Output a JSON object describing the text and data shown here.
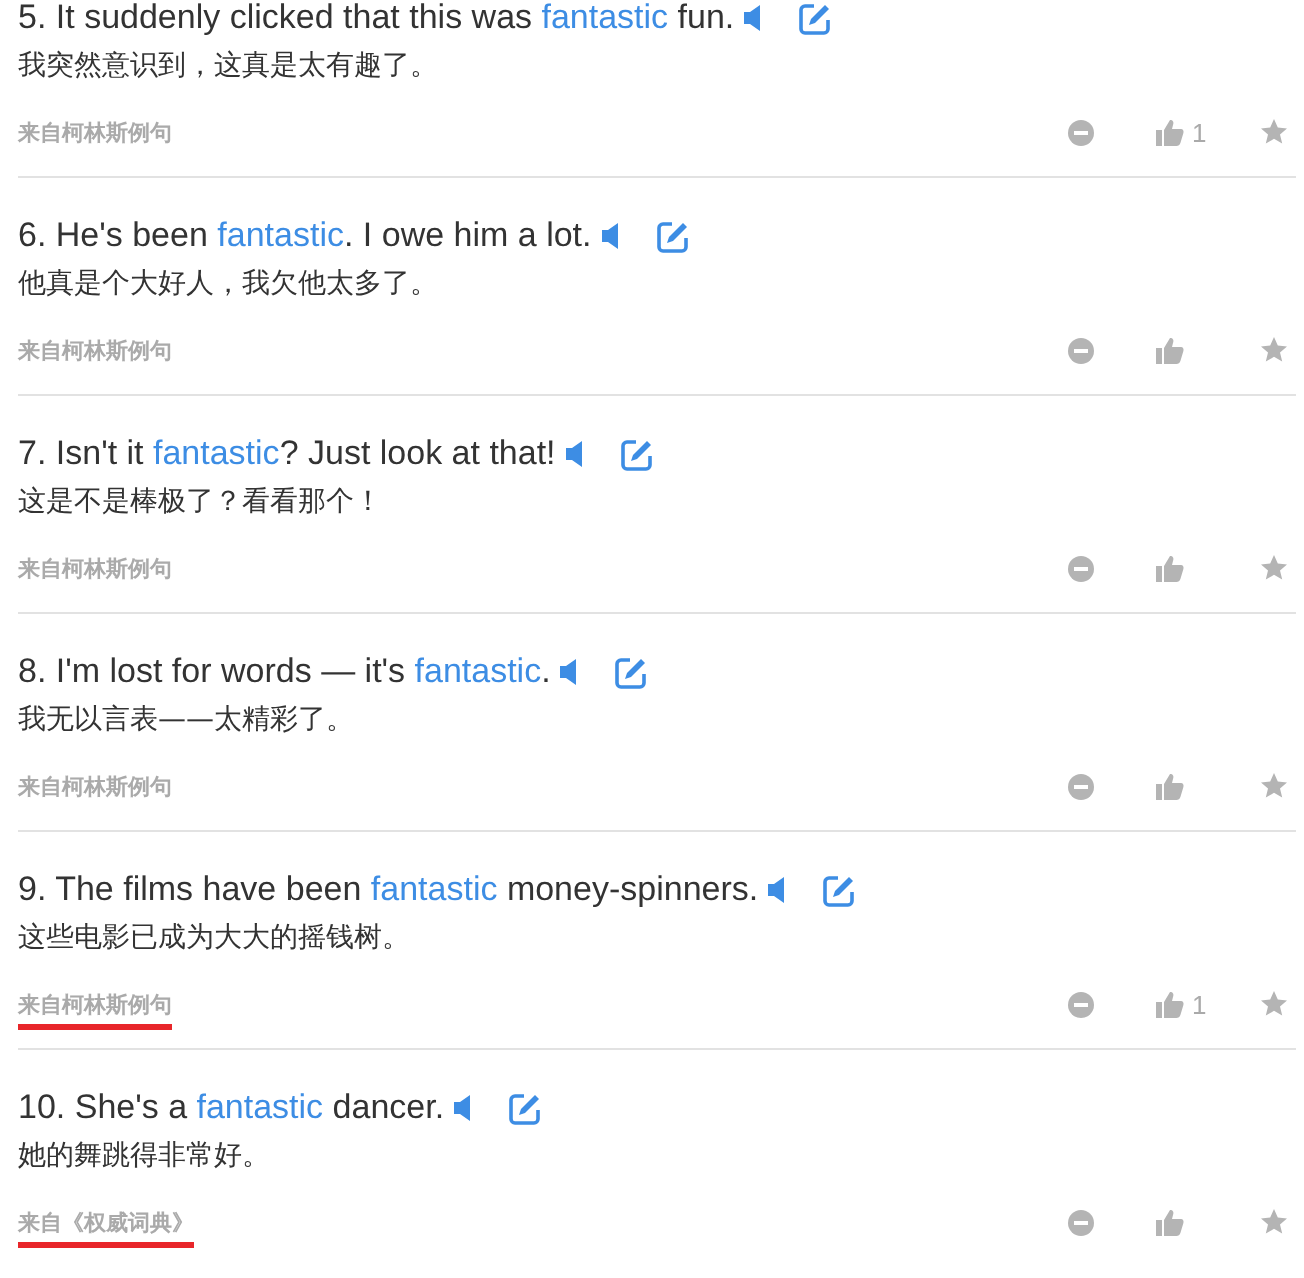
{
  "examples": [
    {
      "parts": [
        {
          "text": "5. It suddenly clicked that this was ",
          "highlight": false
        },
        {
          "text": "fantastic",
          "highlight": true
        },
        {
          "text": " fun.",
          "highlight": false
        }
      ],
      "translation": "我突然意识到，这真是太有趣了。",
      "source": "来自柯林斯例句",
      "underlined": false,
      "likes": "1"
    },
    {
      "parts": [
        {
          "text": "6. He's been ",
          "highlight": false
        },
        {
          "text": "fantastic",
          "highlight": true
        },
        {
          "text": ". I owe him a lot.",
          "highlight": false
        }
      ],
      "translation": "他真是个大好人，我欠他太多了。",
      "source": "来自柯林斯例句",
      "underlined": false
    },
    {
      "parts": [
        {
          "text": "7. Isn't it ",
          "highlight": false
        },
        {
          "text": "fantastic",
          "highlight": true
        },
        {
          "text": "? Just look at that!",
          "highlight": false
        }
      ],
      "translation": "这是不是棒极了？看看那个！",
      "source": "来自柯林斯例句",
      "underlined": false
    },
    {
      "parts": [
        {
          "text": "8. I'm lost for words — it's ",
          "highlight": false
        },
        {
          "text": "fantastic",
          "highlight": true
        },
        {
          "text": ".",
          "highlight": false
        }
      ],
      "translation": "我无以言表——太精彩了。",
      "source": "来自柯林斯例句",
      "underlined": false
    },
    {
      "parts": [
        {
          "text": "9. The films have been ",
          "highlight": false
        },
        {
          "text": "fantastic",
          "highlight": true
        },
        {
          "text": " money-spinners.",
          "highlight": false
        }
      ],
      "translation": "这些电影已成为大大的摇钱树。",
      "source": "来自柯林斯例句",
      "underlined": true,
      "likes": "1"
    },
    {
      "parts": [
        {
          "text": "10. She's a ",
          "highlight": false
        },
        {
          "text": "fantastic",
          "highlight": true
        },
        {
          "text": " dancer.",
          "highlight": false
        }
      ],
      "translation": "她的舞跳得非常好。",
      "source": "来自《权威词典》",
      "underlined": true
    }
  ]
}
